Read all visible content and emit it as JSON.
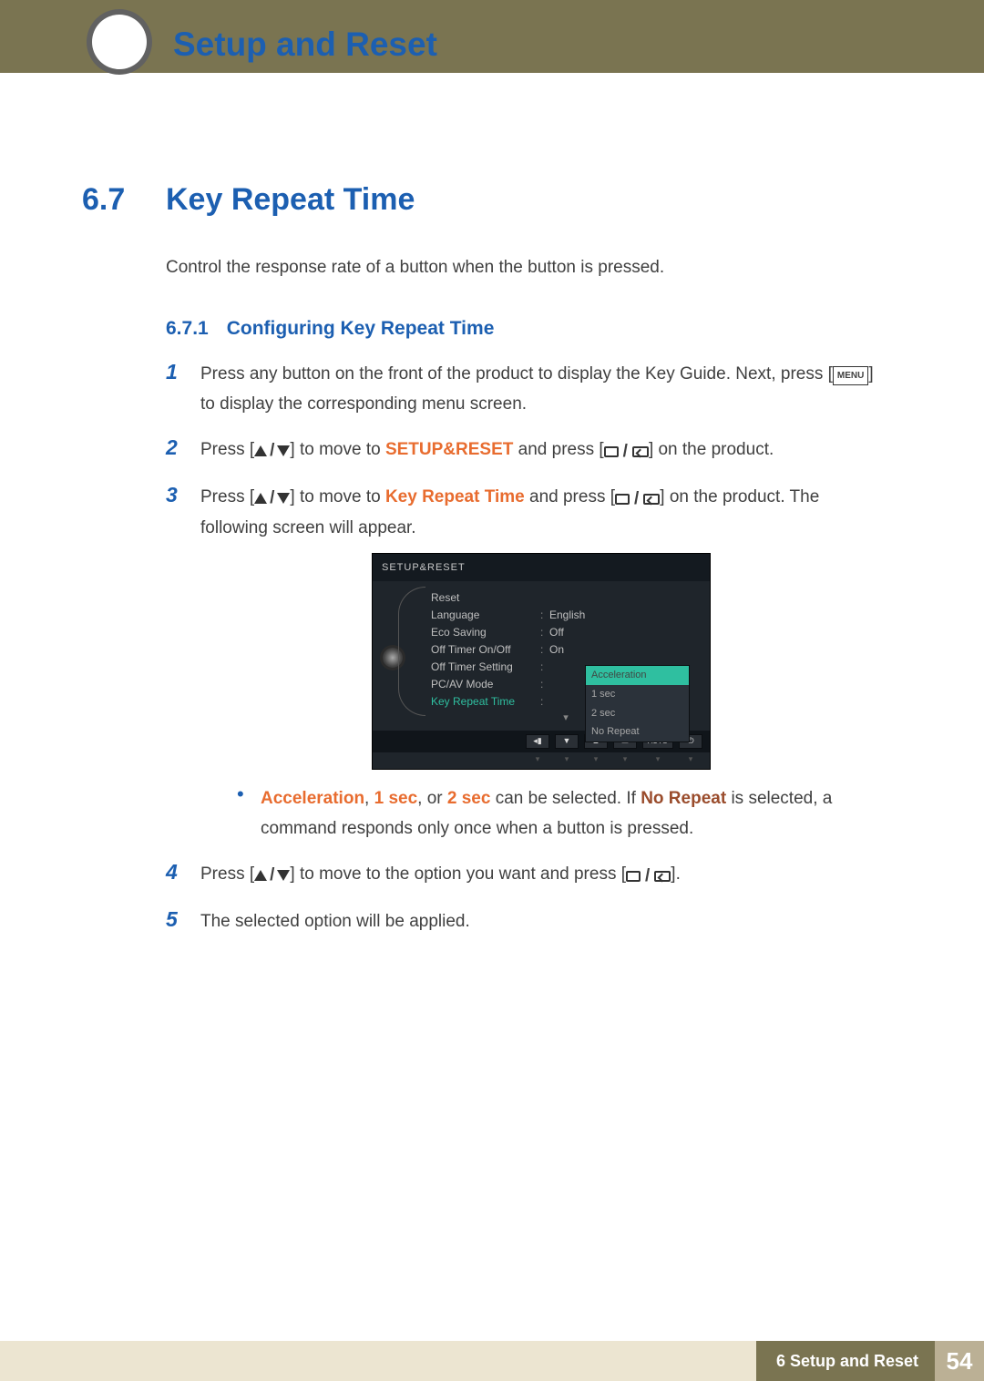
{
  "header": {
    "chapter_title": "Setup and Reset"
  },
  "section": {
    "number": "6.7",
    "title": "Key Repeat Time",
    "intro": "Control the response rate of a button when the button is pressed."
  },
  "subsection": {
    "number": "6.7.1",
    "title": "Configuring Key Repeat Time"
  },
  "steps": {
    "s1a": "Press any button on the front of the product to display the Key Guide. Next, press [",
    "s1b": "] to display the corresponding menu screen.",
    "s2a": "Press [",
    "s2b": "] to move to ",
    "s2c": "SETUP&RESET",
    "s2d": " and press [",
    "s2e": "] on the product.",
    "s3a": "Press [",
    "s3b": "] to move to ",
    "s3c": "Key Repeat Time",
    "s3d": " and press [",
    "s3e": "] on the product. The following screen will appear.",
    "bullet": {
      "a": "Acceleration",
      "c1": ", ",
      "b": "1 sec",
      "c2": ", or ",
      "c": "2 sec",
      "mid": " can be selected. If ",
      "d": "No Repeat",
      "after": " is selected, a command responds only once when a button is pressed."
    },
    "s4a": "Press [",
    "s4b": "] to move to the option you want and press [",
    "s4c": "].",
    "s5": "The selected option will be applied."
  },
  "step_nums": {
    "n1": "1",
    "n2": "2",
    "n3": "3",
    "n4": "4",
    "n5": "5"
  },
  "menu_chip": "MENU",
  "osd": {
    "title": "SETUP&RESET",
    "rows": [
      {
        "label": "Reset",
        "value": ""
      },
      {
        "label": "Language",
        "value": "English"
      },
      {
        "label": "Eco Saving",
        "value": "Off"
      },
      {
        "label": "Off Timer On/Off",
        "value": "On"
      },
      {
        "label": "Off Timer Setting",
        "value": ""
      },
      {
        "label": "PC/AV Mode",
        "value": ""
      },
      {
        "label": "Key Repeat Time",
        "value": ""
      }
    ],
    "options": [
      "Acceleration",
      "1 sec",
      "2 sec",
      "No Repeat"
    ],
    "auto": "AUTO"
  },
  "footer": {
    "chapter_label": "6 Setup and Reset",
    "page": "54"
  }
}
